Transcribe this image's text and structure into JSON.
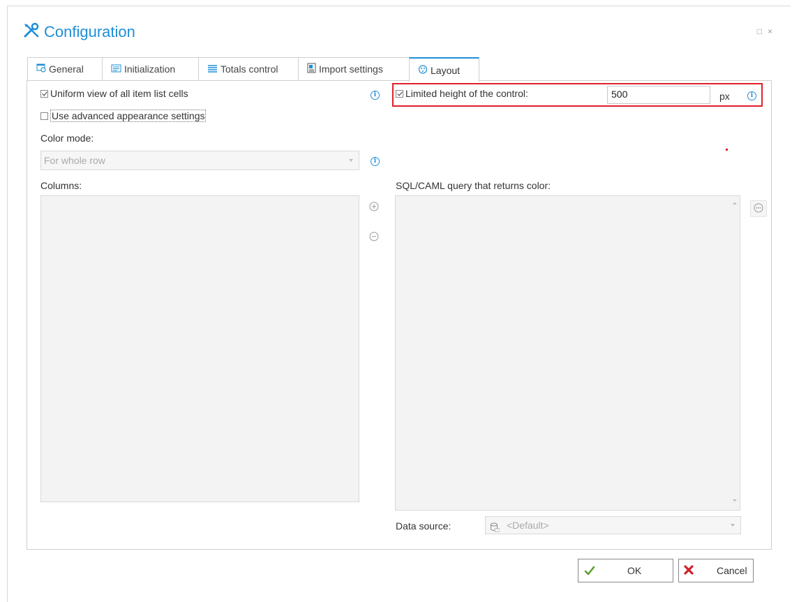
{
  "window": {
    "title": "Configuration",
    "controls": [
      "□",
      "×"
    ]
  },
  "tabs": [
    {
      "label": "General",
      "icon": "general-tab-icon",
      "active": false
    },
    {
      "label": "Initialization",
      "icon": "initialization-tab-icon",
      "active": false
    },
    {
      "label": "Totals control",
      "icon": "totals-control-tab-icon",
      "active": false
    },
    {
      "label": "Import settings",
      "icon": "import-settings-tab-icon",
      "active": false
    },
    {
      "label": "Layout",
      "icon": "layout-tab-icon",
      "active": true
    }
  ],
  "layout": {
    "uniform_view": {
      "label": "Uniform view of all item list cells",
      "checked": true
    },
    "advanced_appearance": {
      "label": "Use advanced appearance settings",
      "checked": false
    },
    "color_mode": {
      "label": "Color mode:",
      "value": "For whole row"
    },
    "columns": {
      "label": "Columns:"
    },
    "limited_height": {
      "label": "Limited height of the control:",
      "checked": true,
      "value": "500",
      "unit": "px"
    },
    "sql_query": {
      "label": "SQL/CAML query that returns color:"
    },
    "data_source": {
      "label": "Data source:",
      "value": "<Default>"
    }
  },
  "buttons": {
    "ok": "OK",
    "cancel": "Cancel"
  },
  "colors": {
    "accent": "#1e8fd6",
    "highlight": "#e0202a",
    "ok_icon": "#5aa02c",
    "cancel_icon": "#d0202a"
  }
}
